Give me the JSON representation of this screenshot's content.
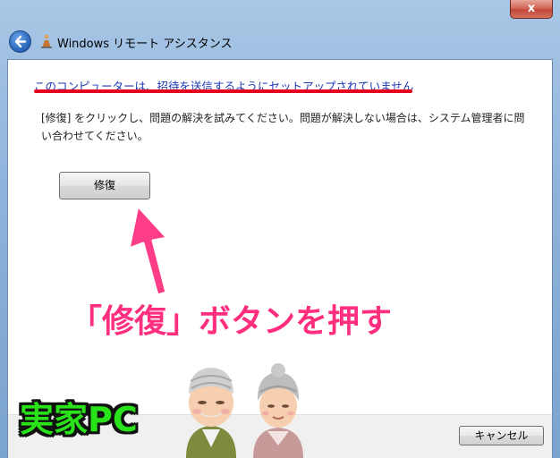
{
  "window": {
    "title": "Windows リモート アシスタンス",
    "close_glyph": "x",
    "app_icon": "remote-assistance-icon",
    "back_icon": "back-arrow-icon"
  },
  "main": {
    "heading": "このコンピューターは、招待を送信するようにセットアップされていません",
    "description": "[修復] をクリックし、問題の解決を試みてください。問題が解決しない場合は、システム管理者に問い合わせてください。",
    "repair_button": "修復"
  },
  "footer": {
    "cancel_button": "キャンセル"
  },
  "overlay": {
    "instruction": "「修復」ボタンを押す",
    "home_pc_label": "実家PC",
    "instruction_color": "#ff2e7e",
    "label_color": "#29e21a",
    "underline_color": "#e6001f"
  }
}
